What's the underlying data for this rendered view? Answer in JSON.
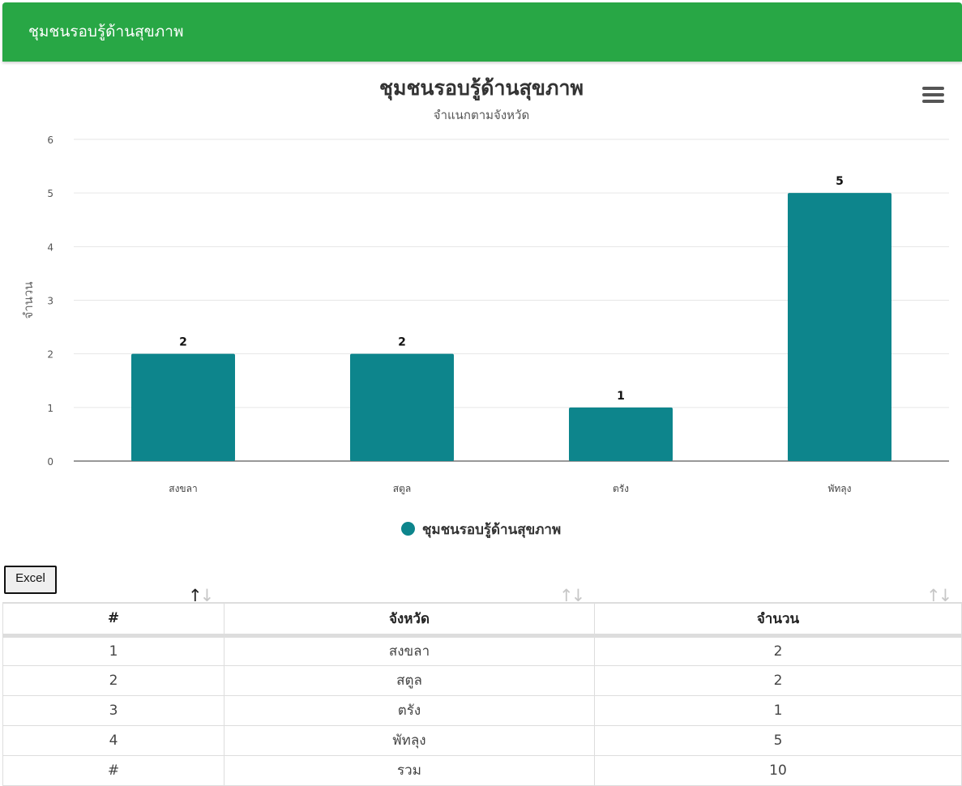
{
  "header": {
    "title": "ชุมชนรอบรู้ด้านสุขภาพ"
  },
  "colors": {
    "header": "#28a745",
    "bar": "#0d858c",
    "grid": "#e6e6e6"
  },
  "chart_data": {
    "type": "bar",
    "title": "ชุมชนรอบรู้ด้านสุขภาพ",
    "subtitle": "จำแนกตามจังหวัด",
    "ylabel": "จำนวน",
    "xlabel": "",
    "categories": [
      "สงขลา",
      "สตูล",
      "ตรัง",
      "พัทลุง"
    ],
    "series": [
      {
        "name": "ชุมชนรอบรู้ด้านสุขภาพ",
        "values": [
          2,
          2,
          1,
          5
        ]
      }
    ],
    "ylim": [
      0,
      6
    ],
    "yticks": [
      0,
      1,
      2,
      3,
      4,
      5,
      6
    ],
    "grid": true,
    "legend": "bottom-center",
    "data_labels": true
  },
  "toolbar": {
    "excel_label": "Excel"
  },
  "table": {
    "headers": [
      "#",
      "จังหวัด",
      "จำนวน"
    ],
    "rows": [
      [
        "1",
        "สงขลา",
        "2"
      ],
      [
        "2",
        "สตูล",
        "2"
      ],
      [
        "3",
        "ตรัง",
        "1"
      ],
      [
        "4",
        "พัทลุง",
        "5"
      ],
      [
        "#",
        "รวม",
        "10"
      ]
    ]
  },
  "icons": {
    "menu": "hamburger-menu-icon",
    "sort": "sort-arrows-icon"
  }
}
